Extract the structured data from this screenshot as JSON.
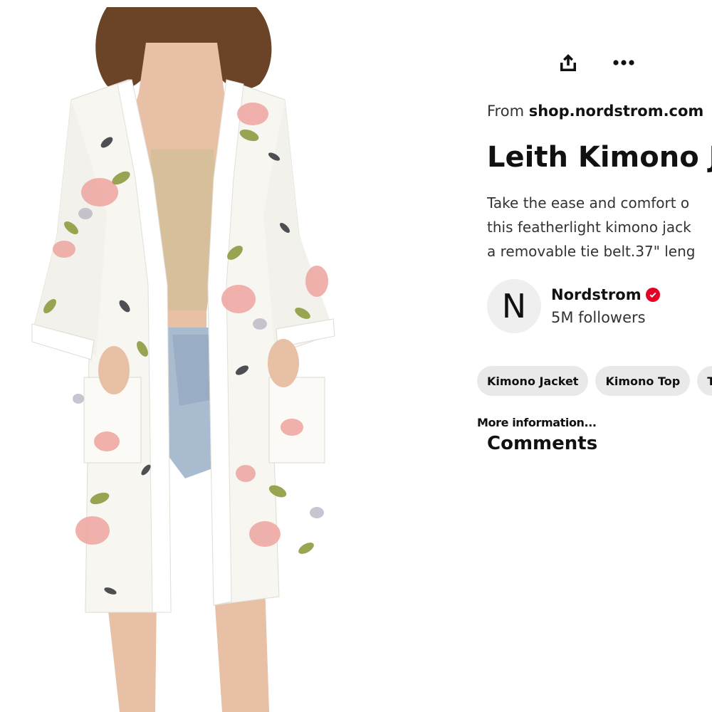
{
  "header": {
    "share_icon": "share-upload-icon",
    "more_icon": "ellipsis-icon"
  },
  "pin": {
    "source_prefix": "From",
    "source_domain": "shop.nordstrom.com",
    "title": "Leith Kimono Ja",
    "description_lines": [
      "Take the ease and comfort o",
      "this featherlight kimono jack",
      "a removable tie belt.37\" leng"
    ]
  },
  "creator": {
    "avatar_letter": "N",
    "name": "Nordstrom",
    "verified_icon": "verified-check-icon",
    "followers": "5M followers"
  },
  "tags": [
    "Kimono Jacket",
    "Kimono Top",
    "Ta"
  ],
  "more_info_label": "More information...",
  "comments_heading": "Comments",
  "colors": {
    "verified": "#e60023",
    "tag_bg": "#e9e9e9",
    "avatar_bg": "#efefef",
    "kimono_base": "#f7f6f1",
    "print_pink": "#eea9a3",
    "print_olive": "#8f9a3f",
    "print_dark": "#2f3137",
    "hair": "#6b4326",
    "skin": "#e7c0a6",
    "denim": "#a9bccf"
  }
}
